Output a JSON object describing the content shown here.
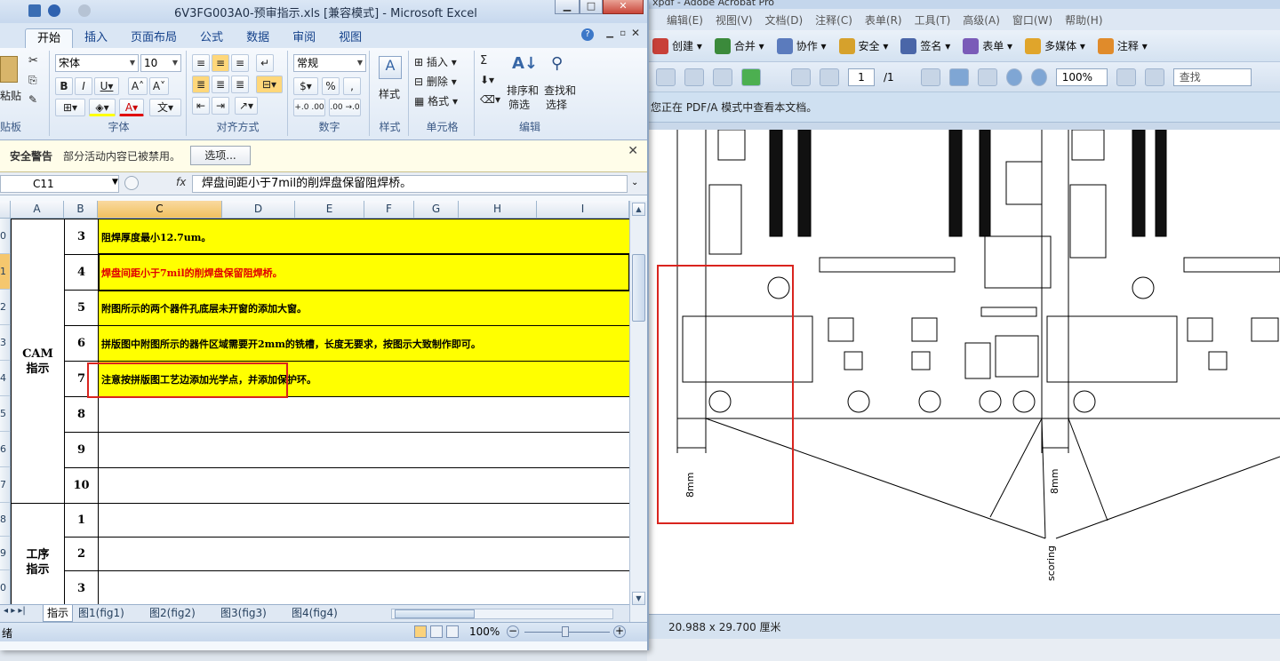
{
  "excel": {
    "title": "6V3FG003A0-预审指示.xls  [兼容模式] - Microsoft Excel",
    "ribbon_tabs": [
      "开始",
      "插入",
      "页面布局",
      "公式",
      "数据",
      "审阅",
      "视图"
    ],
    "clipboard": {
      "paste": "粘贴",
      "label": "贴板"
    },
    "font": {
      "name": "宋体",
      "size": "10",
      "label": "字体"
    },
    "alignment": {
      "label": "对齐方式"
    },
    "number": {
      "format": "常规",
      "label": "数字",
      "percent": "%",
      "comma": ",",
      "inc_decimal": "+.0 .00",
      "dec_decimal": ".00 →.0"
    },
    "styles": {
      "label": "样式"
    },
    "cells": {
      "insert": "插入",
      "delete": "删除",
      "format": "格式",
      "label": "单元格"
    },
    "editing": {
      "sort": "排序和",
      "filter": "筛选",
      "find": "查找和",
      "select": "选择",
      "label": "编辑",
      "sigma": "Σ"
    },
    "security": {
      "title": "安全警告",
      "message": "部分活动内容已被禁用。",
      "options_button": "选项..."
    },
    "namebox": "C11",
    "fx": "fx",
    "formula": "焊盘间距小于7mil的削焊盘保留阻焊桥。",
    "columns": [
      "A",
      "B",
      "C",
      "D",
      "E",
      "F",
      "G",
      "H",
      "I"
    ],
    "row_numbers": [
      "0",
      "1",
      "2",
      "3",
      "4",
      "5",
      "6",
      "7",
      "8",
      "9",
      "0"
    ],
    "groups": {
      "cam": "CAM\n指示",
      "process": "工序\n指示"
    },
    "cam_rows": [
      {
        "num": "3",
        "text": "阻焊厚度最小12.7um。",
        "red": false
      },
      {
        "num": "4",
        "text": "焊盘间距小于7mil的削焊盘保留阻焊桥。",
        "red": true
      },
      {
        "num": "5",
        "text": "附图所示的两个器件孔底层未开窗的添加大窗。",
        "red": false
      },
      {
        "num": "6",
        "text": "拼版图中附图所示的器件区域需要开2mm的铣槽，长度无要求，按图示大致制作即可。",
        "red": false
      },
      {
        "num": "7",
        "text": "注意按拼版图工艺边添加光学点，并添加保护环。",
        "red": false
      },
      {
        "num": "8",
        "text": ""
      },
      {
        "num": "9",
        "text": ""
      },
      {
        "num": "10",
        "text": ""
      }
    ],
    "process_rows": [
      {
        "num": "1"
      },
      {
        "num": "2"
      },
      {
        "num": "3"
      }
    ],
    "sheet_tabs": [
      "指示",
      "图1(fig1)",
      "图2(fig2)",
      "图3(fig3)",
      "图4(fig4)"
    ],
    "status": {
      "ready": "绪",
      "zoom": "100%"
    }
  },
  "acrobat": {
    "title": "xpdf - Adobe Acrobat Pro",
    "menu": [
      "编辑(E)",
      "视图(V)",
      "文档(D)",
      "注释(C)",
      "表单(R)",
      "工具(T)",
      "高级(A)",
      "窗口(W)",
      "帮助(H)"
    ],
    "toolbar": [
      "创建",
      "合并",
      "协作",
      "安全",
      "签名",
      "表单",
      "多媒体",
      "注释"
    ],
    "page_current": "1",
    "page_total": "/1",
    "zoom": "100%",
    "search_placeholder": "查找",
    "info_bar": "您正在 PDF/A 模式中查看本文档。",
    "page_size": "20.988 x 29.700 厘米",
    "drawing": {
      "dim_label": "8mm",
      "scoring_label": "scoring"
    }
  }
}
